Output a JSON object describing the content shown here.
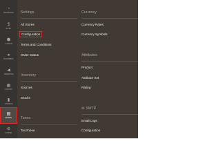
{
  "sidebar": {
    "items": [
      {
        "icon": "dashboard-icon",
        "glyph": "◔",
        "label": "DASHBOARD"
      },
      {
        "icon": "sales-icon",
        "glyph": "$",
        "label": "SALES"
      },
      {
        "icon": "catalog-icon",
        "glyph": "⬢",
        "label": "CATALOG"
      },
      {
        "icon": "customers-icon",
        "glyph": "●",
        "label": "CUSTOMERS"
      },
      {
        "icon": "marketing-icon",
        "glyph": "◀",
        "label": "MARKETING"
      },
      {
        "icon": "content-icon",
        "glyph": "▦",
        "label": "CONTENT"
      },
      {
        "icon": "reports-icon",
        "glyph": "▮",
        "label": "REPORTS"
      },
      {
        "icon": "stores-icon",
        "glyph": "▤",
        "label": "STORES"
      },
      {
        "icon": "system-icon",
        "glyph": "⚙",
        "label": "SYSTEM"
      }
    ],
    "active": "STORES"
  },
  "menu": {
    "settings": {
      "title": "Settings",
      "links": [
        "All Stores",
        "Configuration",
        "Terms and Conditions",
        "Order Status"
      ]
    },
    "inventory": {
      "title": "Inventory",
      "links": [
        "Sources",
        "Stocks"
      ]
    },
    "taxes": {
      "title": "Taxes",
      "links": [
        "Tax Rules"
      ]
    },
    "currency": {
      "title": "Currency",
      "links": [
        "Currency Rates",
        "Currency Symbols"
      ]
    },
    "attributes": {
      "title": "Attributes",
      "links": [
        "Product",
        "Attribute Set",
        "Rating"
      ]
    },
    "smtp": {
      "icon": "smtp-icon",
      "title": "SMTP",
      "links": [
        "Email Logs",
        "Configuration"
      ]
    }
  },
  "colors": {
    "sidebar_bg": "#373330",
    "panel_bg": "#403934",
    "highlight": "#e22626"
  }
}
